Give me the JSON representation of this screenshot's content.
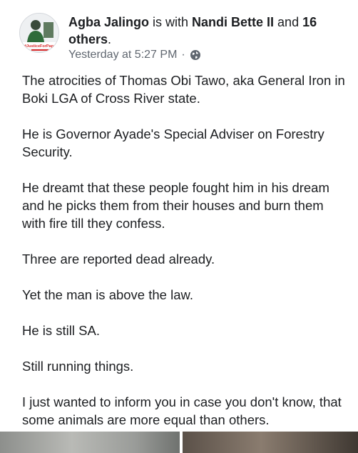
{
  "post": {
    "author": "Agba Jalingo",
    "with_text": " is with ",
    "tagged_person": "Nandi Bette II",
    "and_text": " and ",
    "others_count": "16 others",
    "period": ".",
    "timestamp": "Yesterday at 5:27 PM",
    "separator": "·",
    "privacy_icon": "globe-icon",
    "avatar_caption": "#JusticeForPapa",
    "paragraphs": [
      "The atrocities of Thomas Obi Tawo, aka General Iron in Boki LGA of Cross River state.",
      "He is Governor Ayade's Special Adviser on Forestry Security.",
      "He dreamt that these people fought him in his dream and he picks them from their houses and burn them with fire till they confess.",
      "Three are reported dead already.",
      "Yet the man is above the law.",
      "He is still SA.",
      "Still running things.",
      "I just wanted to inform you in case you don't know, that some animals are more equal than others."
    ]
  },
  "colors": {
    "text": "#1c1e21",
    "meta": "#606770",
    "avatar_tag": "#d92b2b"
  }
}
